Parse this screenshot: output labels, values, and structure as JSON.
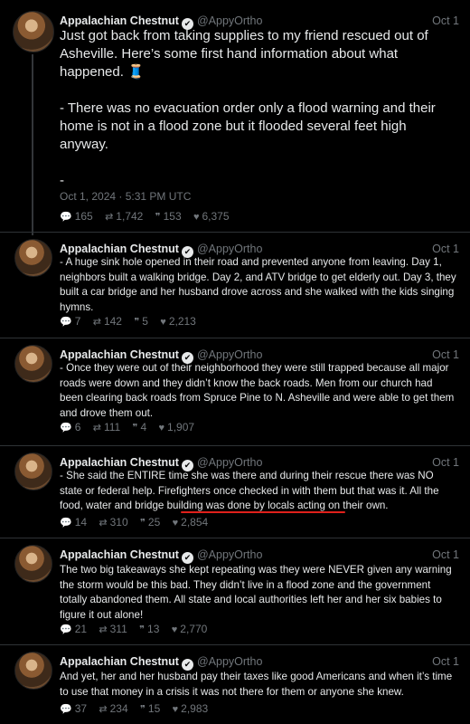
{
  "author": {
    "name": "Appalachian Chestnut",
    "handle": "@AppyOrtho",
    "verified_glyph": "✔"
  },
  "tweets": [
    {
      "date": "Oct 1",
      "paragraphs": [
        "Just got back from taking supplies to my friend rescued out of Asheville. Here’s some first hand information about what happened. 🧵",
        "- There was no evacuation order only a flood warning and their home is not in a flood zone but it flooded several feet high anyway.",
        "-"
      ],
      "timestamp": "Oct 1, 2024 · 5:31 PM UTC",
      "replies": "165",
      "retweets": "1,742",
      "quotes": "153",
      "likes": "6,375"
    },
    {
      "date": "Oct 1",
      "text": "- A huge sink hole opened in their road and prevented anyone from leaving. Day 1, neighbors built a walking bridge. Day 2, and ATV bridge to get elderly out. Day 3, they built a car bridge and her husband drove across and she walked with the kids singing hymns.",
      "replies": "7",
      "retweets": "142",
      "quotes": "5",
      "likes": "2,213"
    },
    {
      "date": "Oct 1",
      "text": "- Once they were out of their neighborhood they were still trapped because all major roads were down and they didn’t know the back roads. Men from our church had been clearing back roads from Spruce Pine to N. Asheville and were able to get them and drove them out.",
      "replies": "6",
      "retweets": "111",
      "quotes": "4",
      "likes": "1,907"
    },
    {
      "date": "Oct 1",
      "text": "- She said the ENTIRE time she was there and during their rescue there was NO state or federal help. Firefighters once checked in with them but that was it. All the food, water and bridge building was done by locals acting on their own.",
      "replies": "14",
      "retweets": "310",
      "quotes": "25",
      "likes": "2,854"
    },
    {
      "date": "Oct 1",
      "text": "The two big takeaways she kept repeating was they were NEVER given any warning the storm would be this bad. They didn’t live in a flood zone and the government totally abandoned them. All state and local authorities left her and her six babies to figure it out alone!",
      "replies": "21",
      "retweets": "311",
      "quotes": "13",
      "likes": "2,770"
    },
    {
      "date": "Oct 1",
      "text": "And yet, her and her husband pay their taxes like good Americans and when it’s time to use that money in a crisis it was not there for them or anyone she knew.",
      "replies": "37",
      "retweets": "234",
      "quotes": "15",
      "likes": "2,983"
    }
  ],
  "icons": {
    "reply": "💬",
    "retweet": "⇄",
    "quote": "❞",
    "like": "♥"
  },
  "colors": {
    "background": "#000000",
    "text": "#e7e9ea",
    "muted": "#71767b",
    "annotation_underline": "#e0201b"
  }
}
